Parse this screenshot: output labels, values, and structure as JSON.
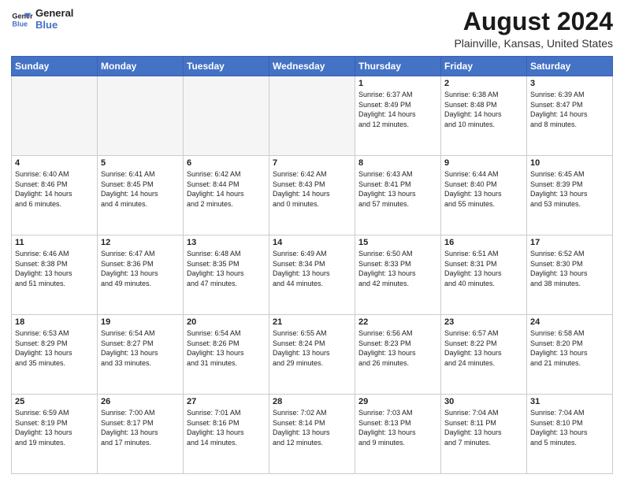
{
  "header": {
    "logo_line1": "General",
    "logo_line2": "Blue",
    "main_title": "August 2024",
    "subtitle": "Plainville, Kansas, United States"
  },
  "weekdays": [
    "Sunday",
    "Monday",
    "Tuesday",
    "Wednesday",
    "Thursday",
    "Friday",
    "Saturday"
  ],
  "weeks": [
    [
      {
        "day": "",
        "info": ""
      },
      {
        "day": "",
        "info": ""
      },
      {
        "day": "",
        "info": ""
      },
      {
        "day": "",
        "info": ""
      },
      {
        "day": "1",
        "info": "Sunrise: 6:37 AM\nSunset: 8:49 PM\nDaylight: 14 hours\nand 12 minutes."
      },
      {
        "day": "2",
        "info": "Sunrise: 6:38 AM\nSunset: 8:48 PM\nDaylight: 14 hours\nand 10 minutes."
      },
      {
        "day": "3",
        "info": "Sunrise: 6:39 AM\nSunset: 8:47 PM\nDaylight: 14 hours\nand 8 minutes."
      }
    ],
    [
      {
        "day": "4",
        "info": "Sunrise: 6:40 AM\nSunset: 8:46 PM\nDaylight: 14 hours\nand 6 minutes."
      },
      {
        "day": "5",
        "info": "Sunrise: 6:41 AM\nSunset: 8:45 PM\nDaylight: 14 hours\nand 4 minutes."
      },
      {
        "day": "6",
        "info": "Sunrise: 6:42 AM\nSunset: 8:44 PM\nDaylight: 14 hours\nand 2 minutes."
      },
      {
        "day": "7",
        "info": "Sunrise: 6:42 AM\nSunset: 8:43 PM\nDaylight: 14 hours\nand 0 minutes."
      },
      {
        "day": "8",
        "info": "Sunrise: 6:43 AM\nSunset: 8:41 PM\nDaylight: 13 hours\nand 57 minutes."
      },
      {
        "day": "9",
        "info": "Sunrise: 6:44 AM\nSunset: 8:40 PM\nDaylight: 13 hours\nand 55 minutes."
      },
      {
        "day": "10",
        "info": "Sunrise: 6:45 AM\nSunset: 8:39 PM\nDaylight: 13 hours\nand 53 minutes."
      }
    ],
    [
      {
        "day": "11",
        "info": "Sunrise: 6:46 AM\nSunset: 8:38 PM\nDaylight: 13 hours\nand 51 minutes."
      },
      {
        "day": "12",
        "info": "Sunrise: 6:47 AM\nSunset: 8:36 PM\nDaylight: 13 hours\nand 49 minutes."
      },
      {
        "day": "13",
        "info": "Sunrise: 6:48 AM\nSunset: 8:35 PM\nDaylight: 13 hours\nand 47 minutes."
      },
      {
        "day": "14",
        "info": "Sunrise: 6:49 AM\nSunset: 8:34 PM\nDaylight: 13 hours\nand 44 minutes."
      },
      {
        "day": "15",
        "info": "Sunrise: 6:50 AM\nSunset: 8:33 PM\nDaylight: 13 hours\nand 42 minutes."
      },
      {
        "day": "16",
        "info": "Sunrise: 6:51 AM\nSunset: 8:31 PM\nDaylight: 13 hours\nand 40 minutes."
      },
      {
        "day": "17",
        "info": "Sunrise: 6:52 AM\nSunset: 8:30 PM\nDaylight: 13 hours\nand 38 minutes."
      }
    ],
    [
      {
        "day": "18",
        "info": "Sunrise: 6:53 AM\nSunset: 8:29 PM\nDaylight: 13 hours\nand 35 minutes."
      },
      {
        "day": "19",
        "info": "Sunrise: 6:54 AM\nSunset: 8:27 PM\nDaylight: 13 hours\nand 33 minutes."
      },
      {
        "day": "20",
        "info": "Sunrise: 6:54 AM\nSunset: 8:26 PM\nDaylight: 13 hours\nand 31 minutes."
      },
      {
        "day": "21",
        "info": "Sunrise: 6:55 AM\nSunset: 8:24 PM\nDaylight: 13 hours\nand 29 minutes."
      },
      {
        "day": "22",
        "info": "Sunrise: 6:56 AM\nSunset: 8:23 PM\nDaylight: 13 hours\nand 26 minutes."
      },
      {
        "day": "23",
        "info": "Sunrise: 6:57 AM\nSunset: 8:22 PM\nDaylight: 13 hours\nand 24 minutes."
      },
      {
        "day": "24",
        "info": "Sunrise: 6:58 AM\nSunset: 8:20 PM\nDaylight: 13 hours\nand 21 minutes."
      }
    ],
    [
      {
        "day": "25",
        "info": "Sunrise: 6:59 AM\nSunset: 8:19 PM\nDaylight: 13 hours\nand 19 minutes."
      },
      {
        "day": "26",
        "info": "Sunrise: 7:00 AM\nSunset: 8:17 PM\nDaylight: 13 hours\nand 17 minutes."
      },
      {
        "day": "27",
        "info": "Sunrise: 7:01 AM\nSunset: 8:16 PM\nDaylight: 13 hours\nand 14 minutes."
      },
      {
        "day": "28",
        "info": "Sunrise: 7:02 AM\nSunset: 8:14 PM\nDaylight: 13 hours\nand 12 minutes."
      },
      {
        "day": "29",
        "info": "Sunrise: 7:03 AM\nSunset: 8:13 PM\nDaylight: 13 hours\nand 9 minutes."
      },
      {
        "day": "30",
        "info": "Sunrise: 7:04 AM\nSunset: 8:11 PM\nDaylight: 13 hours\nand 7 minutes."
      },
      {
        "day": "31",
        "info": "Sunrise: 7:04 AM\nSunset: 8:10 PM\nDaylight: 13 hours\nand 5 minutes."
      }
    ]
  ]
}
